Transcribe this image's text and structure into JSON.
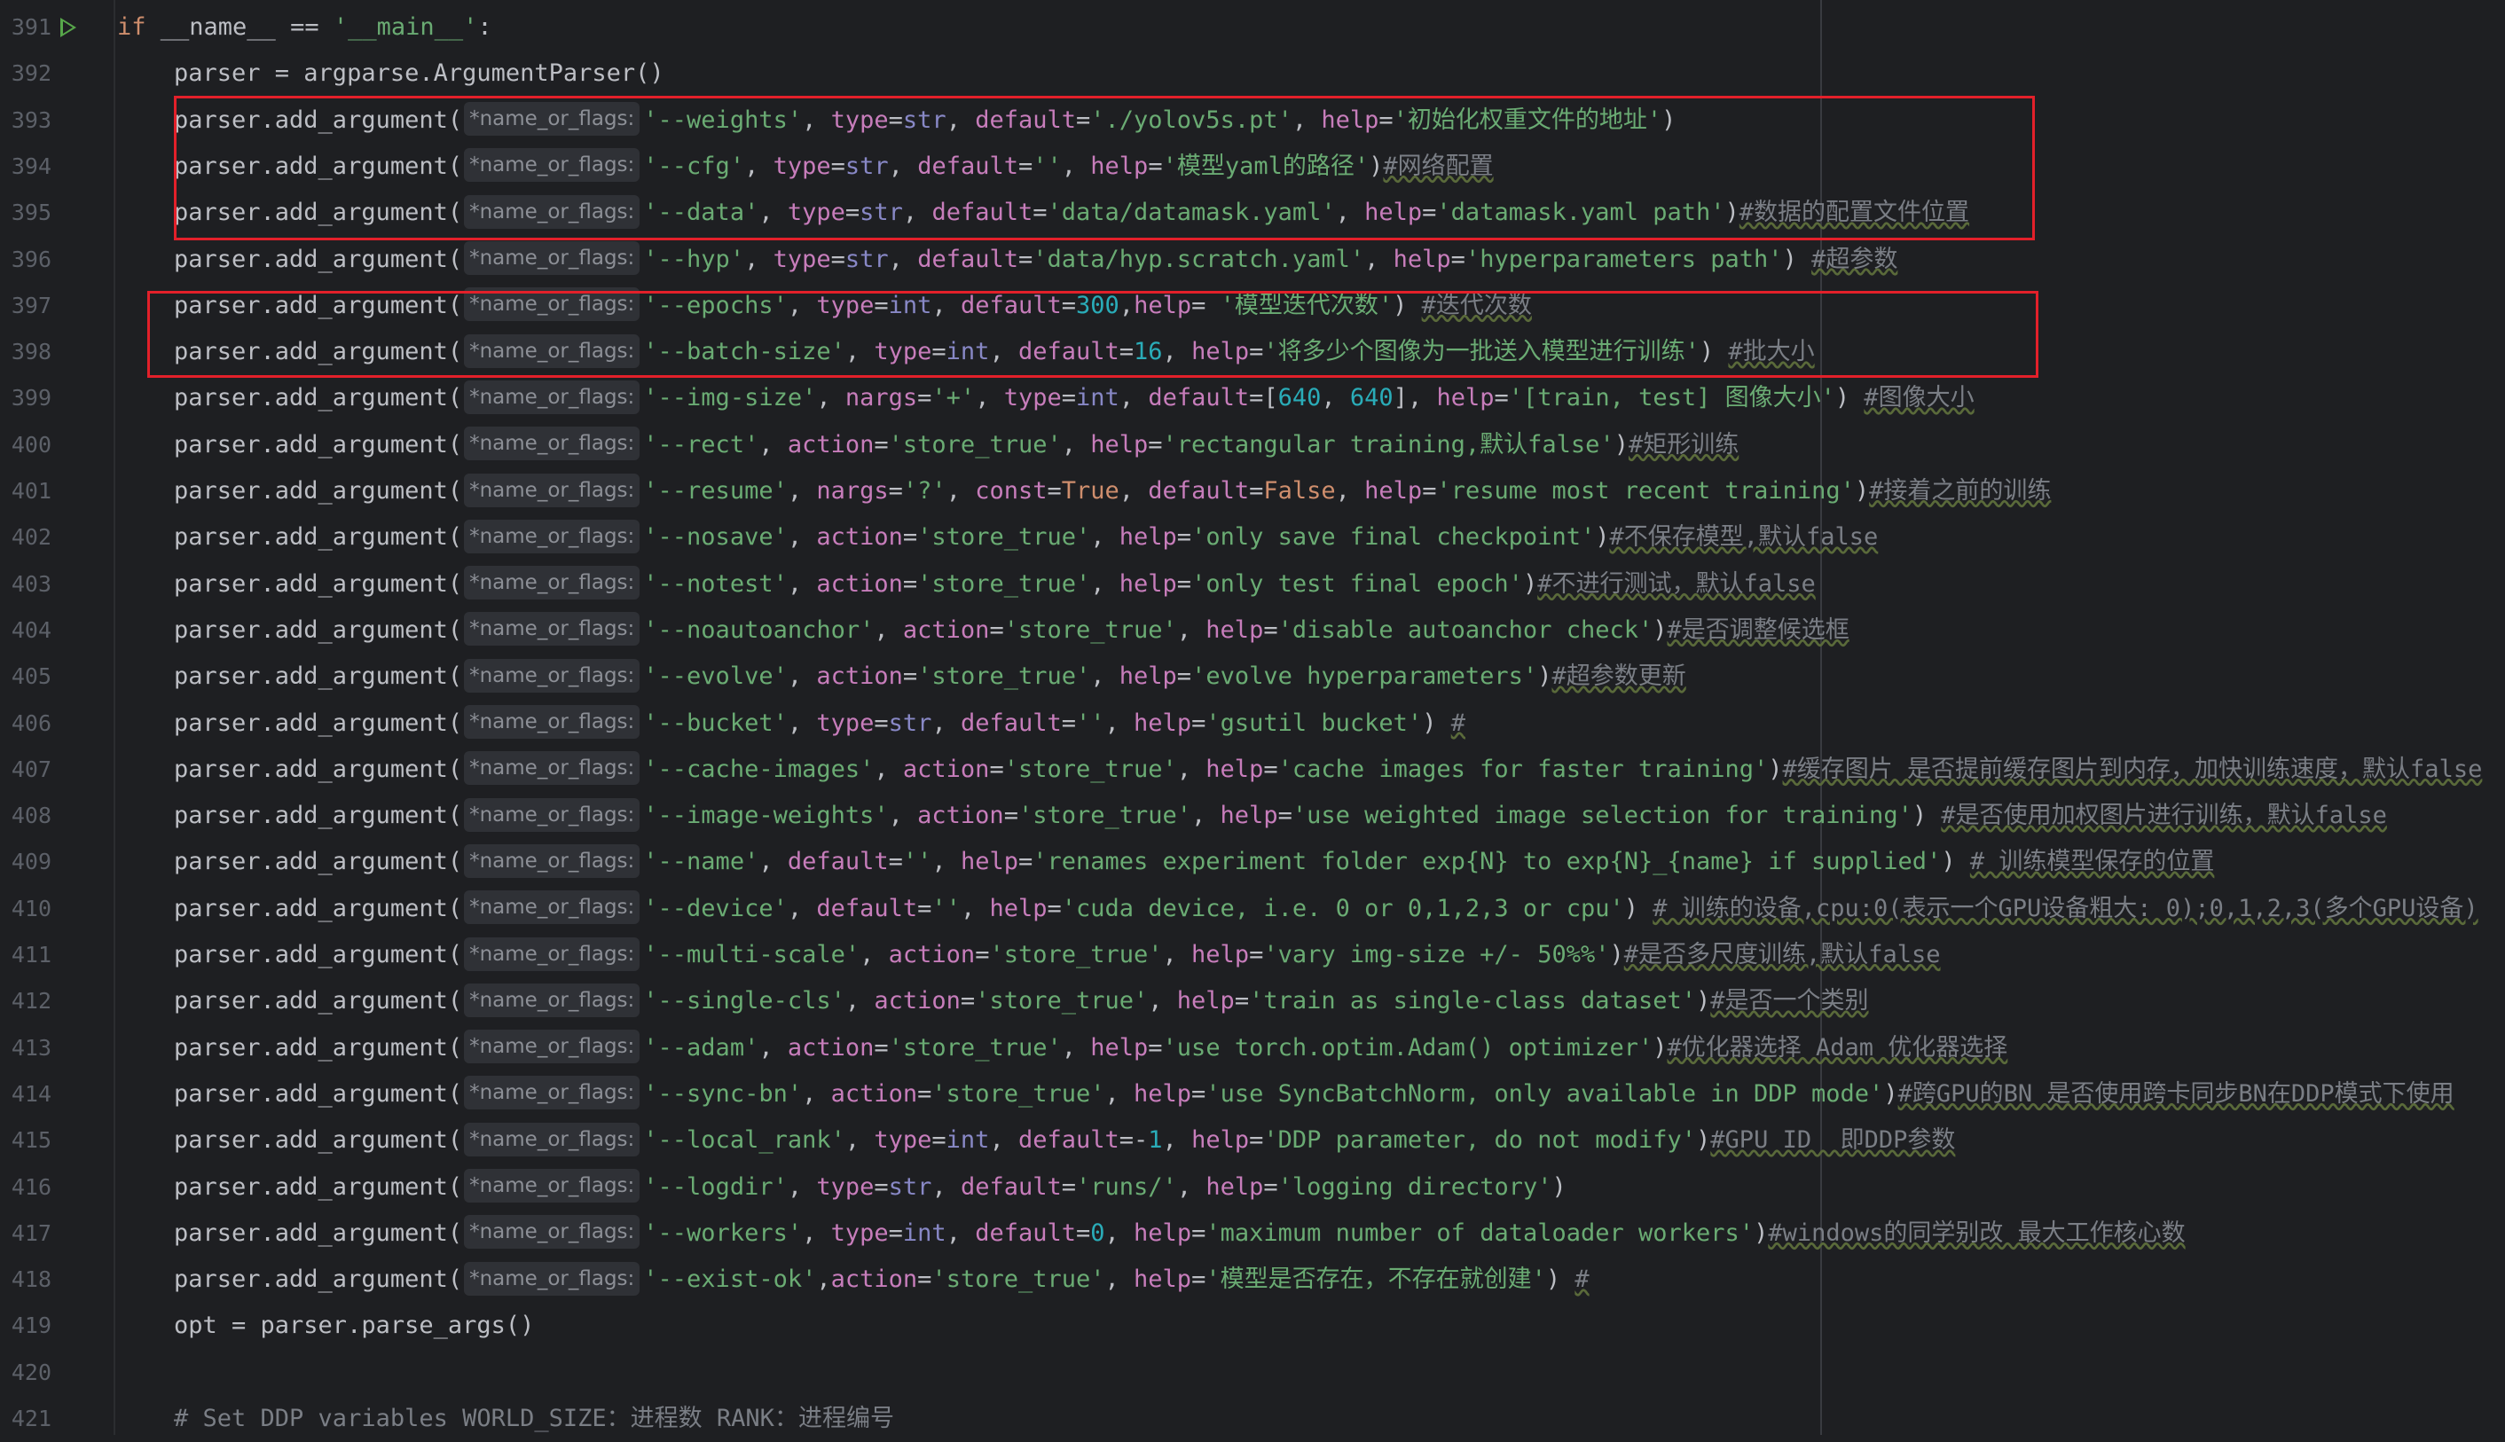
{
  "editor": {
    "hint_label": "*name_or_flags:",
    "lines": [
      {
        "n": "391",
        "code": "if __name__ == '__main__':"
      },
      {
        "n": "392",
        "code": "parser = argparse.ArgumentParser()"
      },
      {
        "n": "393",
        "flag": "'--weights'",
        "rest": ", type=str, default='./yolov5s.pt', help='初始化权重文件的地址')"
      },
      {
        "n": "394",
        "flag": "'--cfg'",
        "rest": ", type=str, default='', help='模型yaml的路径')",
        "comment": "#网络配置"
      },
      {
        "n": "395",
        "flag": "'--data'",
        "rest": ", type=str, default='data/datamask.yaml', help='datamask.yaml path')",
        "comment": "#数据的配置文件位置"
      },
      {
        "n": "396",
        "flag": "'--hyp'",
        "rest": ", type=str, default='data/hyp.scratch.yaml', help='hyperparameters path') ",
        "comment": "#超参数"
      },
      {
        "n": "397",
        "flag": "'--epochs'",
        "rest": ", type=int, default=300,help= '模型迭代次数') ",
        "comment": "#迭代次数"
      },
      {
        "n": "398",
        "flag": "'--batch-size'",
        "rest": ", type=int, default=16, help='将多少个图像为一批送入模型进行训练') ",
        "comment": "#批大小"
      },
      {
        "n": "399",
        "flag": "'--img-size'",
        "rest": ", nargs='+', type=int, default=[640, 640], help='[train, test] 图像大小') ",
        "comment": "#图像大小"
      },
      {
        "n": "400",
        "flag": "'--rect'",
        "rest": ", action='store_true', help='rectangular training,默认false')",
        "comment": "#矩形训练"
      },
      {
        "n": "401",
        "flag": "'--resume'",
        "rest": ", nargs='?', const=True, default=False, help='resume most recent training')",
        "comment": "#接着之前的训练"
      },
      {
        "n": "402",
        "flag": "'--nosave'",
        "rest": ", action='store_true', help='only save final checkpoint')",
        "comment": "#不保存模型,默认false"
      },
      {
        "n": "403",
        "flag": "'--notest'",
        "rest": ", action='store_true', help='only test final epoch')",
        "comment": "#不进行测试，默认false"
      },
      {
        "n": "404",
        "flag": "'--noautoanchor'",
        "rest": ", action='store_true', help='disable autoanchor check')",
        "comment": "#是否调整候选框"
      },
      {
        "n": "405",
        "flag": "'--evolve'",
        "rest": ", action='store_true', help='evolve hyperparameters')",
        "comment": "#超参数更新"
      },
      {
        "n": "406",
        "flag": "'--bucket'",
        "rest": ", type=str, default='', help='gsutil bucket') ",
        "comment": "#"
      },
      {
        "n": "407",
        "flag": "'--cache-images'",
        "rest": ", action='store_true', help='cache images for faster training')",
        "comment": "#缓存图片 是否提前缓存图片到内存，加快训练速度，默认false"
      },
      {
        "n": "408",
        "flag": "'--image-weights'",
        "rest": ", action='store_true', help='use weighted image selection for training') ",
        "comment": "#是否使用加权图片进行训练，默认false"
      },
      {
        "n": "409",
        "flag": "'--name'",
        "rest": ", default='', help='renames experiment folder exp{N} to exp{N}_{name} if supplied') ",
        "comment": "# 训练模型保存的位置"
      },
      {
        "n": "410",
        "flag": "'--device'",
        "rest": ", default='', help='cuda device, i.e. 0 or 0,1,2,3 or cpu') ",
        "comment": "# 训练的设备,cpu:0(表示一个GPU设备粗大: 0);0,1,2,3(多个GPU设备)"
      },
      {
        "n": "411",
        "flag": "'--multi-scale'",
        "rest": ", action='store_true', help='vary img-size +/- 50%%')",
        "comment": "#是否多尺度训练,默认false"
      },
      {
        "n": "412",
        "flag": "'--single-cls'",
        "rest": ", action='store_true', help='train as single-class dataset')",
        "comment": "#是否一个类别"
      },
      {
        "n": "413",
        "flag": "'--adam'",
        "rest": ", action='store_true', help='use torch.optim.Adam() optimizer')",
        "comment": "#优化器选择 Adam 优化器选择"
      },
      {
        "n": "414",
        "flag": "'--sync-bn'",
        "rest": ", action='store_true', help='use SyncBatchNorm, only available in DDP mode')",
        "comment": "#跨GPU的BN 是否使用跨卡同步BN在DDP模式下使用"
      },
      {
        "n": "415",
        "flag": "'--local_rank'",
        "rest": ", type=int, default=-1, help='DDP parameter, do not modify')",
        "comment": "#GPU ID  即DDP参数"
      },
      {
        "n": "416",
        "flag": "'--logdir'",
        "rest": ", type=str, default='runs/', help='logging directory')"
      },
      {
        "n": "417",
        "flag": "'--workers'",
        "rest": ", type=int, default=0, help='maximum number of dataloader workers')",
        "comment": "#windows的同学别改 最大工作核心数"
      },
      {
        "n": "418",
        "flag": "'--exist-ok'",
        "rest": ",action='store_true', help='模型是否存在，不存在就创建') ",
        "comment": "#"
      },
      {
        "n": "419",
        "code": "opt = parser.parse_args()"
      },
      {
        "n": "420",
        "code": ""
      },
      {
        "n": "421",
        "code": "# Set DDP variables WORLD_SIZE：进程数 RANK：进程编号"
      }
    ],
    "call_prefix": "parser.add_argument(",
    "highlight_color": "#e3202a"
  }
}
